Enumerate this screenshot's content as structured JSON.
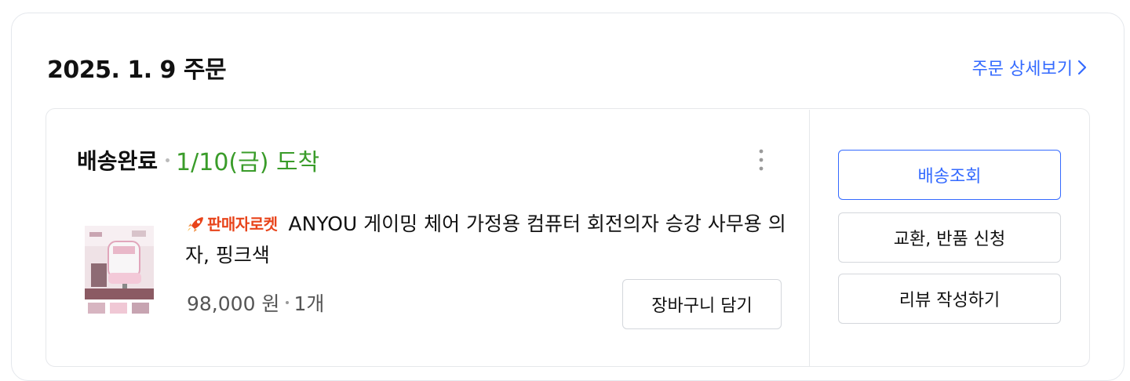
{
  "order": {
    "date_title": "2025. 1. 9 주문",
    "detail_link_label": "주문 상세보기"
  },
  "shipment": {
    "status": "배송완료",
    "arrival": "1/10(금) 도착"
  },
  "product": {
    "badge": "판매자로켓",
    "name": "ANYOU 게이밍 체어 가정용 컴퓨터 회전의자 승강 사무용 의자, 핑크색",
    "price": "98,000 원",
    "quantity": "1개",
    "add_to_cart_label": "장바구니 담기"
  },
  "actions": {
    "track_label": "배송조회",
    "return_label": "교환, 반품 신청",
    "review_label": "리뷰 작성하기"
  },
  "icons": {
    "detail_chevron": "chevron-right-icon",
    "more": "more-vertical-icon",
    "badge": "rocket-icon"
  },
  "colors": {
    "accent_blue": "#346aff",
    "arrival_green": "#3a9c2a",
    "badge_red": "#e8441b",
    "border": "#e6e8eb"
  }
}
